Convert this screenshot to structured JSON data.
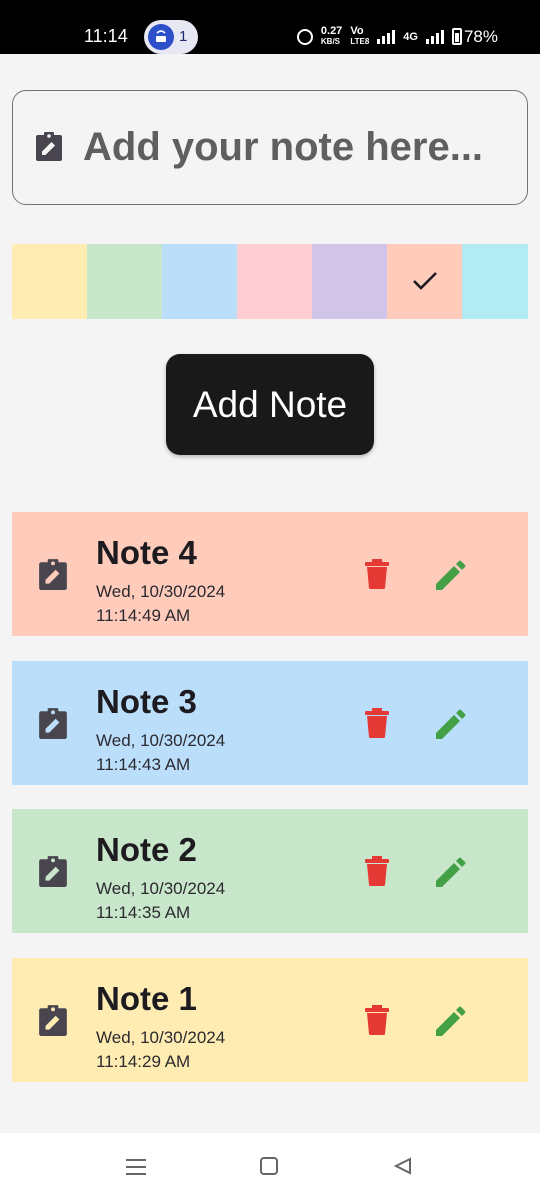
{
  "status_bar": {
    "time": "11:14",
    "hotspot_count": "1",
    "net_speed_value": "0.27",
    "net_speed_unit": "KB/S",
    "volte_top": "Vo",
    "volte_bottom": "LTE8",
    "network_type": "4G",
    "battery_percent": "78%"
  },
  "input": {
    "placeholder": "Add your note here...",
    "value": ""
  },
  "color_picker": {
    "colors": [
      "#ffecb3",
      "#c8e6c9",
      "#bbdefb",
      "#ffcdd2",
      "#d1c4e9",
      "#ffccbc",
      "#b2ebf2"
    ],
    "selected_index": 5
  },
  "add_button": {
    "label": "Add Note"
  },
  "notes": [
    {
      "title": "Note 4",
      "date": "Wed, 10/30/2024",
      "time": "11:14:49 AM",
      "color": "#ffccbc"
    },
    {
      "title": "Note 3",
      "date": "Wed, 10/30/2024",
      "time": "11:14:43 AM",
      "color": "#bbdefb"
    },
    {
      "title": "Note 2",
      "date": "Wed, 10/30/2024",
      "time": "11:14:35 AM",
      "color": "#c8e6c9"
    },
    {
      "title": "Note 1",
      "date": "Wed, 10/30/2024",
      "time": "11:14:29 AM",
      "color": "#ffecb3"
    }
  ],
  "icons": {
    "note": "clipboard-edit-icon",
    "delete": "trash-icon",
    "edit": "pencil-icon",
    "selected": "check-icon"
  },
  "theme": {
    "delete_color": "#e53935",
    "edit_color": "#43a047",
    "icon_color": "#49454f",
    "button_color": "#191919"
  }
}
